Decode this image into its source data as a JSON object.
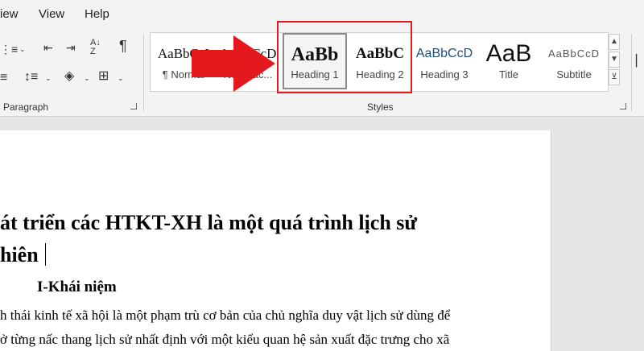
{
  "menubar": {
    "items": [
      "iew",
      "View",
      "Help"
    ]
  },
  "ribbon": {
    "paragraph_group": "Paragraph",
    "styles_group": "Styles",
    "icons": [
      "indent-decrease-icon",
      "indent-increase-icon",
      "sort-icon",
      "pilcrow-icon",
      "line-spacing-icon",
      "shading-icon",
      "borders-icon"
    ]
  },
  "styles": [
    {
      "preview": "AaBbCcI",
      "name": "¶ Normal"
    },
    {
      "preview": "AaBbCcD",
      "name": "No Spac..."
    },
    {
      "preview": "AaBb",
      "name": "Heading 1"
    },
    {
      "preview": "AaBbC",
      "name": "Heading 2"
    },
    {
      "preview": "AaBbCcD",
      "name": "Heading 3"
    },
    {
      "preview": "AaB",
      "name": "Title"
    },
    {
      "preview": "AaBbCcD",
      "name": "Subtitle"
    }
  ],
  "document": {
    "heading_line1": "át triển các HTKT-XH là một quá trình lịch sử",
    "heading_line2": "hiên",
    "subheading": "I-Khái niệm",
    "para_line1": "h thái kinh tế xã hội là một phạm trù cơ bản của chủ nghĩa duy vật lịch sử dùng để",
    "para_line2": "ở từng nấc thang lịch sử nhất định với một kiểu quan hệ sản xuất đặc trưng cho xã"
  },
  "colors": {
    "highlight": "#e3191e",
    "arrow": "#e3191e"
  }
}
